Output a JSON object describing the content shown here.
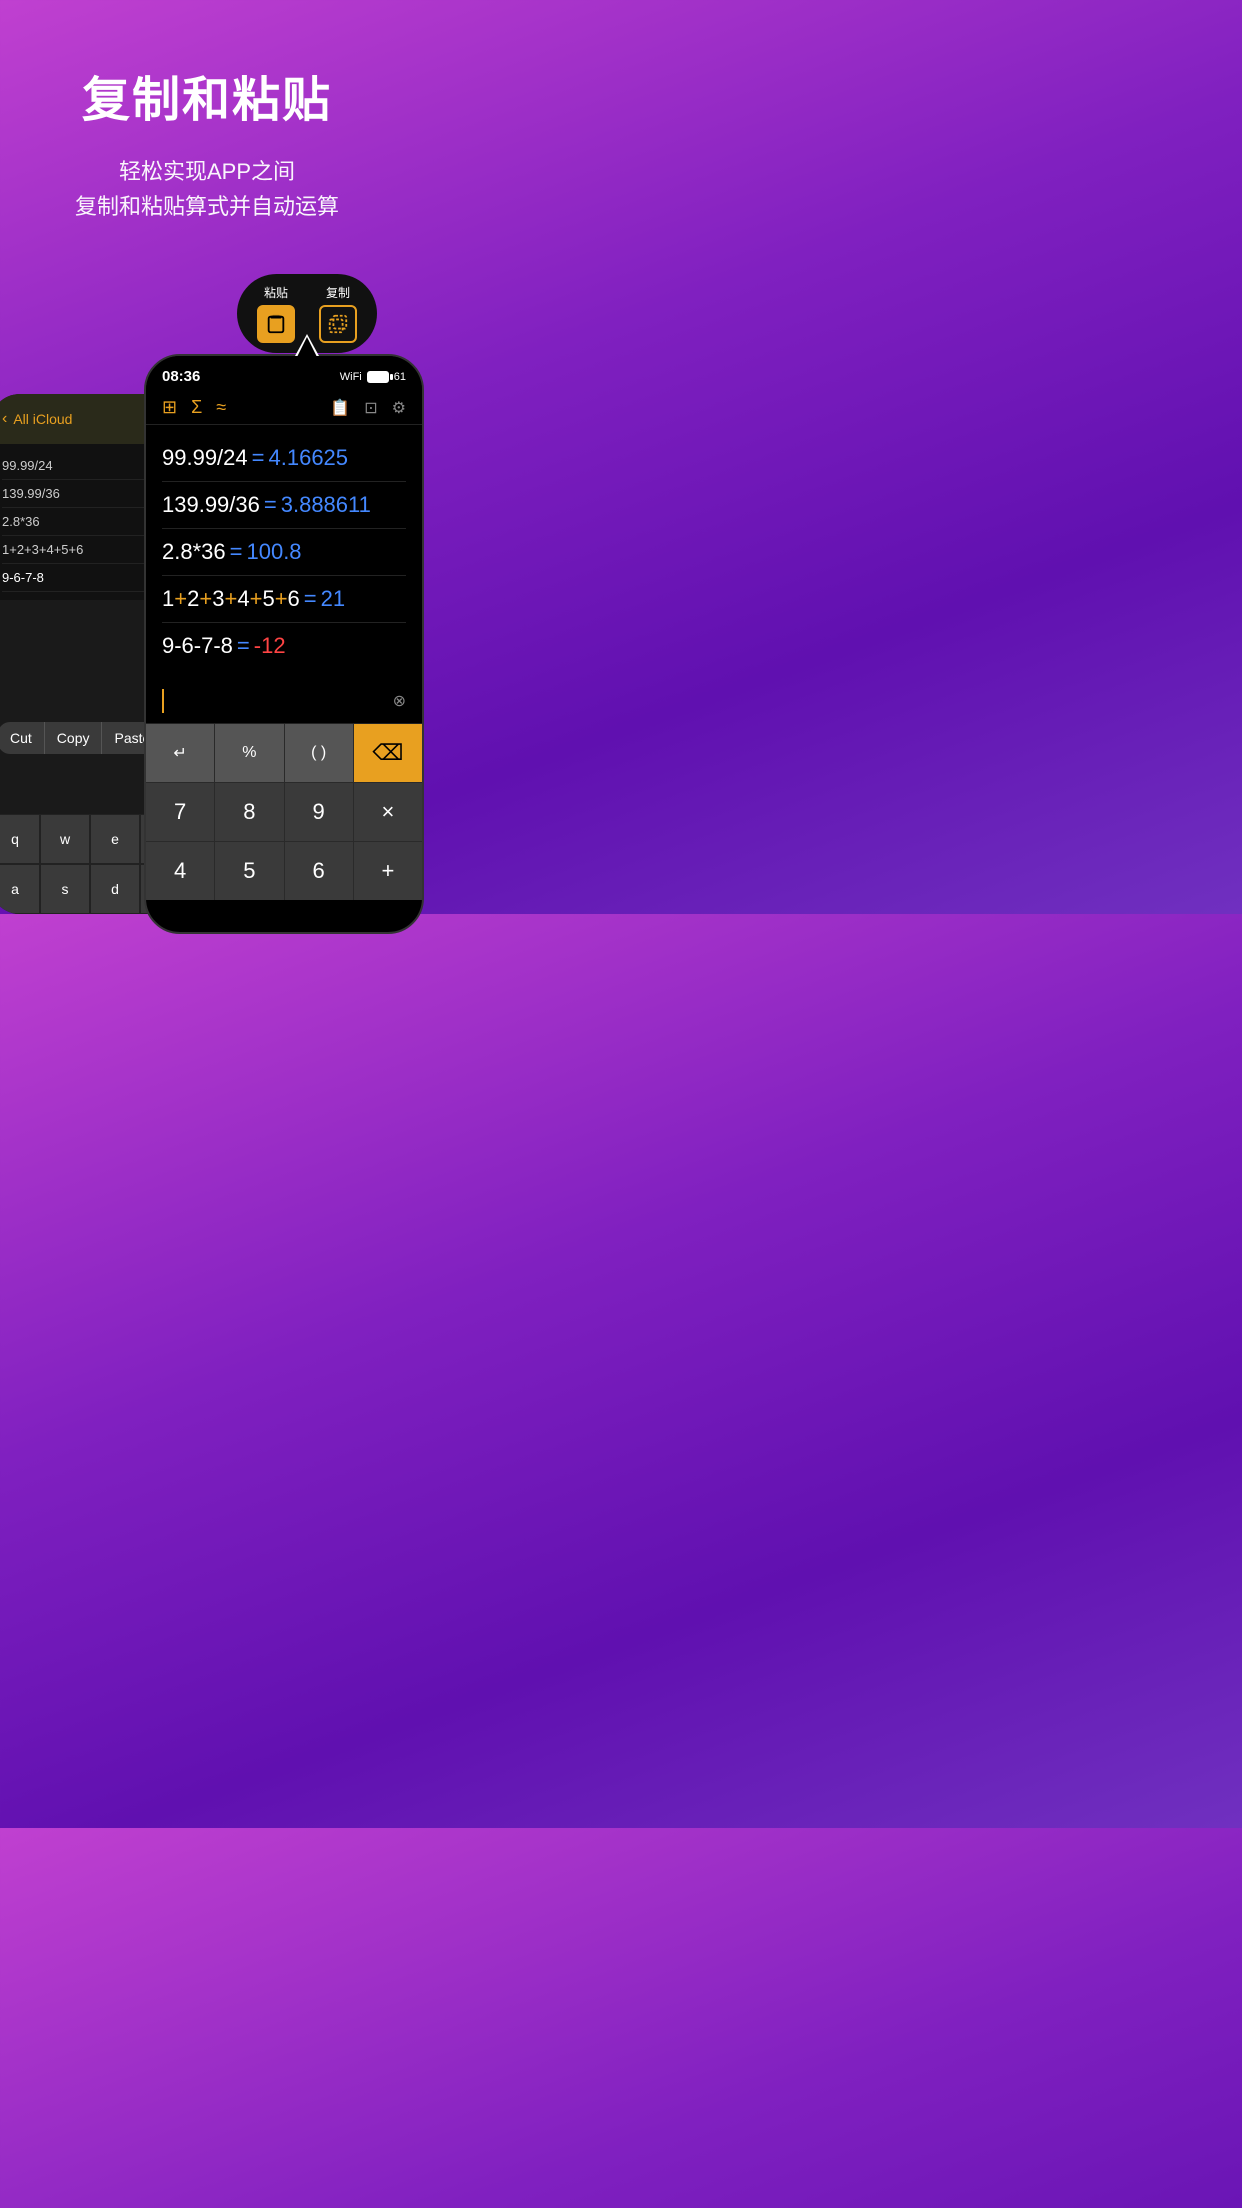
{
  "header": {
    "title": "复制和粘贴",
    "subtitle_line1": "轻松实现APP之间",
    "subtitle_line2": "复制和粘贴算式并自动运算"
  },
  "tooltip": {
    "paste_label": "粘贴",
    "copy_label": "复制"
  },
  "background_phone": {
    "back_text": "All iCloud",
    "list_items": [
      "99.99/24",
      "139.99/36",
      "2.8*36",
      "1+2+3+4+5+6",
      "9-6-7-8"
    ],
    "context_menu": [
      "Cut",
      "Copy",
      "Paste"
    ]
  },
  "main_phone": {
    "status": {
      "time": "08:36",
      "battery": "61"
    },
    "calculations": [
      {
        "expr": "99.99/24",
        "equals": "=",
        "result": "4.16625",
        "negative": false
      },
      {
        "expr": "139.99/36",
        "equals": "=",
        "result": "3.888611",
        "negative": false
      },
      {
        "expr": "2.8*36",
        "equals": "=",
        "result": "100.8",
        "negative": false
      },
      {
        "expr": "1+2+3+4+5+6",
        "equals": "=",
        "result": "21",
        "negative": false,
        "colored": true
      },
      {
        "expr": "9-6-7-8",
        "equals": "=",
        "result": "-12",
        "negative": true
      }
    ],
    "keypad": {
      "row1": [
        "↵",
        "%",
        "( )",
        "⌫"
      ],
      "row2": [
        "7",
        "8",
        "9",
        "×"
      ],
      "row3": [
        "4",
        "5",
        "6",
        "+"
      ]
    }
  }
}
